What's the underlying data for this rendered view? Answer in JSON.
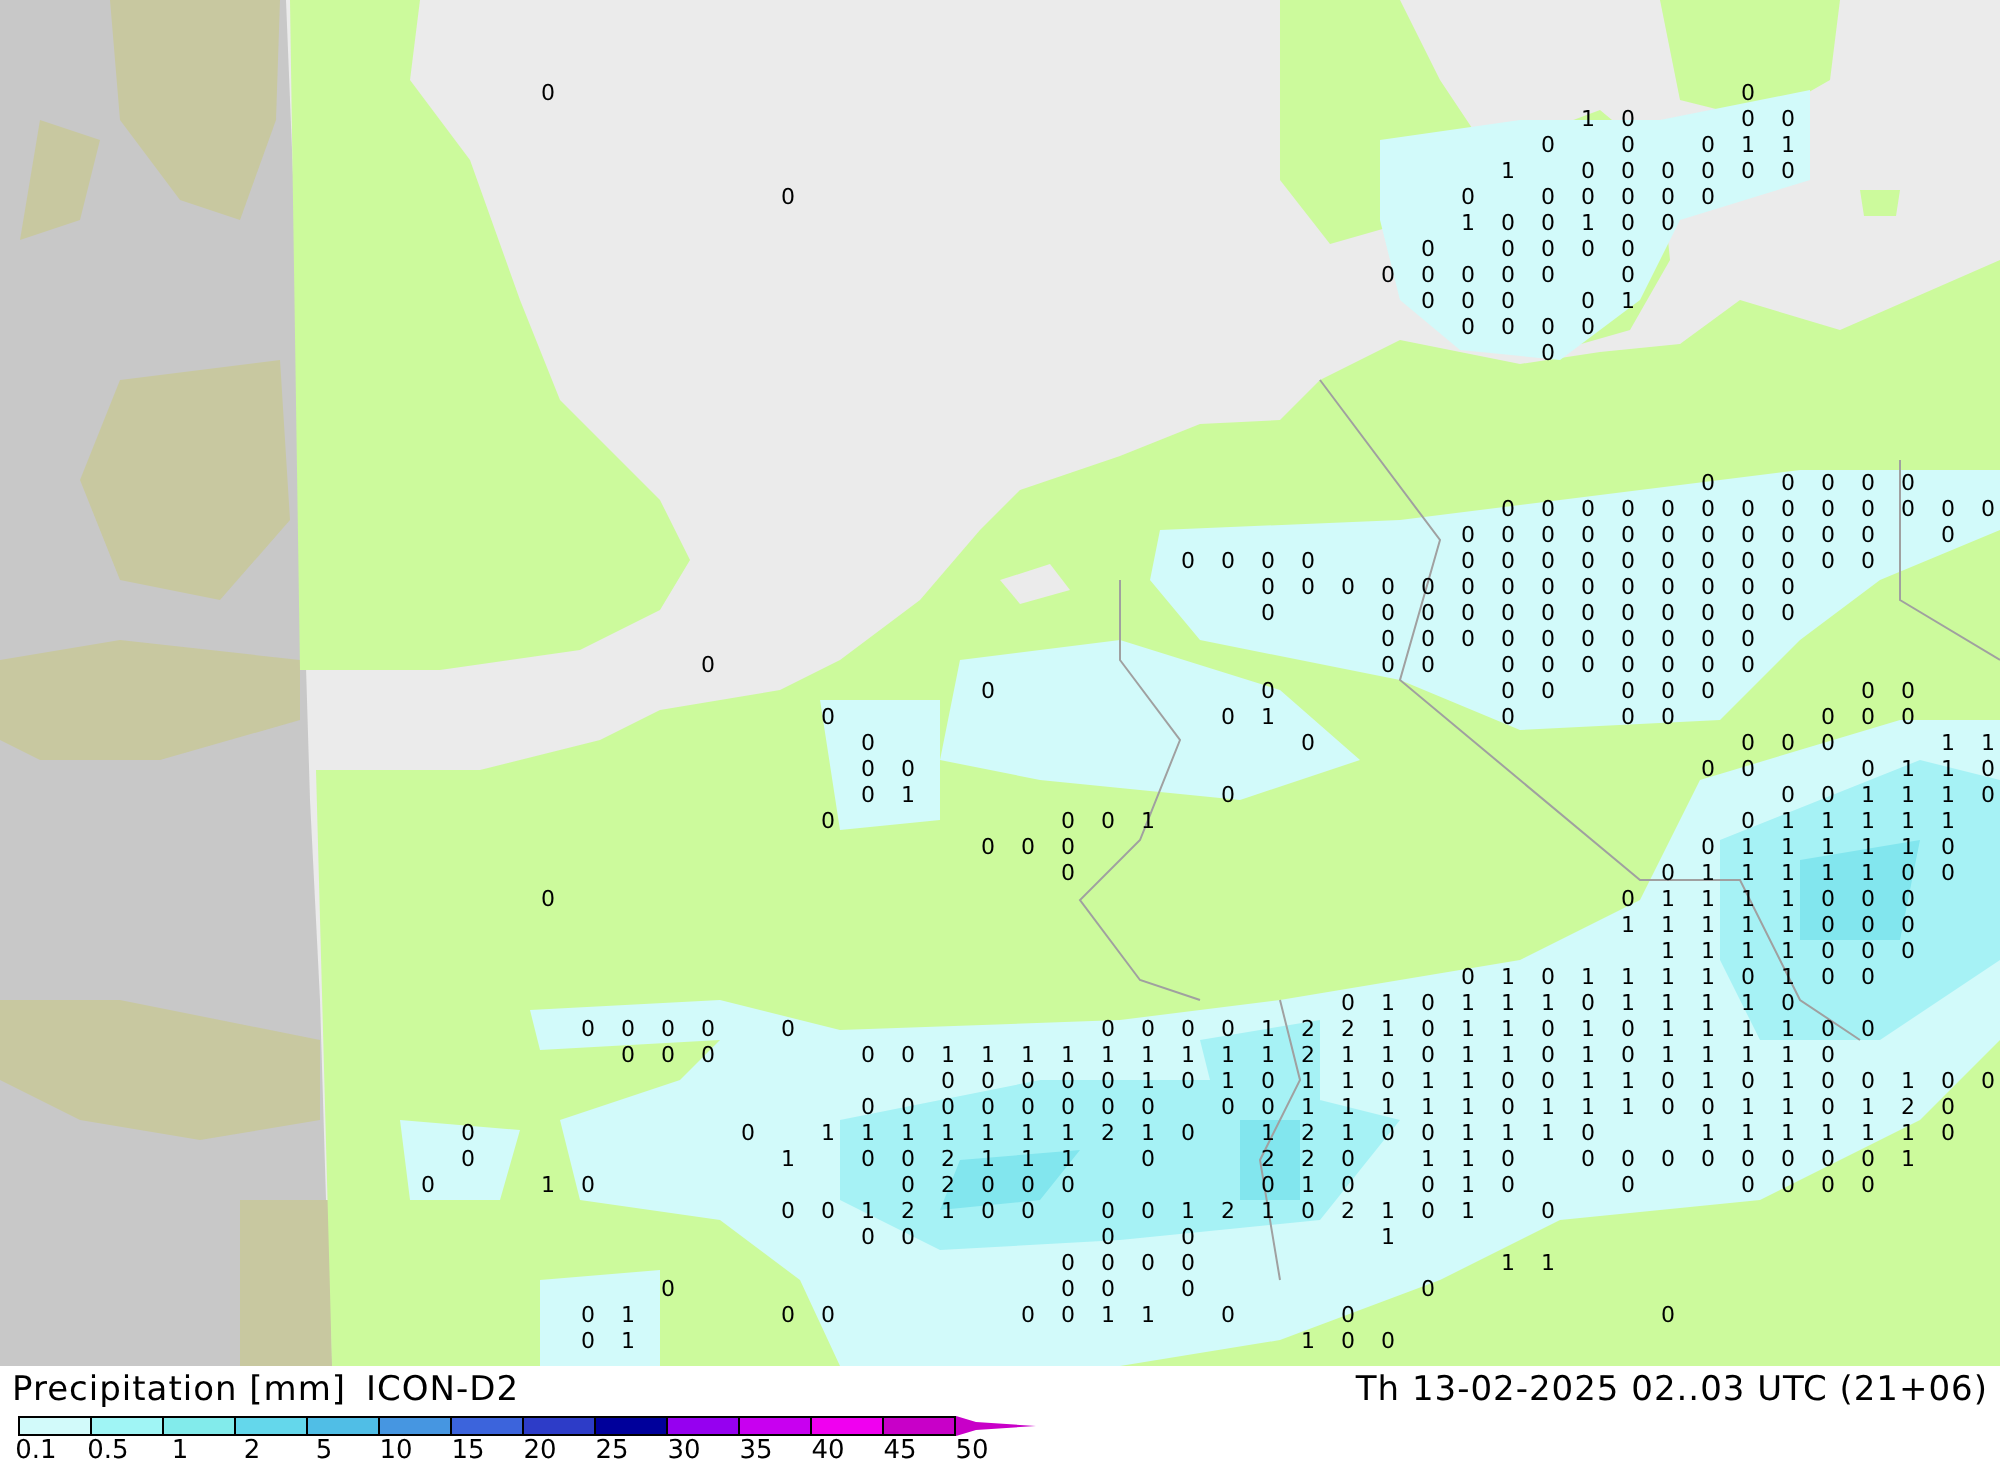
{
  "map": {
    "value_rows": [
      [
        null,
        null,
        null,
        null,
        null,
        null,
        null,
        null,
        null,
        null,
        null,
        null,
        null,
        "0",
        null,
        null,
        null,
        null,
        null,
        null,
        null,
        null,
        null,
        null,
        null,
        null,
        null,
        null,
        null,
        null,
        null,
        null,
        null,
        null,
        null,
        null,
        null,
        null,
        null,
        null,
        null,
        null,
        null,
        "0"
      ],
      [
        null,
        null,
        null,
        null,
        null,
        null,
        null,
        null,
        null,
        null,
        null,
        null,
        null,
        null,
        null,
        null,
        null,
        null,
        null,
        null,
        null,
        null,
        null,
        null,
        null,
        null,
        null,
        null,
        null,
        null,
        null,
        null,
        null,
        null,
        null,
        null,
        null,
        null,
        null,
        "1",
        "0",
        null,
        null,
        "0",
        "0"
      ],
      [
        null,
        null,
        null,
        null,
        null,
        null,
        null,
        null,
        null,
        null,
        null,
        null,
        null,
        null,
        null,
        null,
        null,
        null,
        null,
        null,
        null,
        null,
        null,
        null,
        null,
        null,
        null,
        null,
        null,
        null,
        null,
        null,
        null,
        null,
        null,
        null,
        null,
        null,
        "0",
        null,
        "0",
        null,
        "0",
        "1",
        "1"
      ],
      [
        null,
        null,
        null,
        null,
        null,
        null,
        null,
        null,
        null,
        null,
        null,
        null,
        null,
        null,
        null,
        null,
        null,
        null,
        null,
        null,
        null,
        null,
        null,
        null,
        null,
        null,
        null,
        null,
        null,
        null,
        null,
        null,
        null,
        null,
        null,
        null,
        null,
        "1",
        null,
        "0",
        "0",
        "0",
        "0",
        "0",
        "0"
      ],
      [
        null,
        null,
        null,
        null,
        null,
        null,
        null,
        null,
        null,
        null,
        null,
        null,
        null,
        null,
        null,
        null,
        null,
        null,
        null,
        "0",
        null,
        null,
        null,
        null,
        null,
        null,
        null,
        null,
        null,
        null,
        null,
        null,
        null,
        null,
        null,
        null,
        "0",
        null,
        "0",
        "0",
        "0",
        "0",
        "0"
      ],
      [
        null,
        null,
        null,
        null,
        null,
        null,
        null,
        null,
        null,
        null,
        null,
        null,
        null,
        null,
        null,
        null,
        null,
        null,
        null,
        null,
        null,
        null,
        null,
        null,
        null,
        null,
        null,
        null,
        null,
        null,
        null,
        null,
        null,
        null,
        null,
        null,
        "1",
        "0",
        "0",
        "1",
        "0",
        "0"
      ],
      [
        null,
        null,
        null,
        null,
        null,
        null,
        null,
        null,
        null,
        null,
        null,
        null,
        null,
        null,
        null,
        null,
        null,
        null,
        null,
        null,
        null,
        null,
        null,
        null,
        null,
        null,
        null,
        null,
        null,
        null,
        null,
        null,
        null,
        null,
        null,
        "0",
        null,
        "0",
        "0",
        "0",
        "0"
      ],
      [
        null,
        null,
        null,
        null,
        null,
        null,
        null,
        null,
        null,
        null,
        null,
        null,
        null,
        null,
        null,
        null,
        null,
        null,
        null,
        null,
        null,
        null,
        null,
        null,
        null,
        null,
        null,
        null,
        null,
        null,
        null,
        null,
        null,
        null,
        "0",
        "0",
        "0",
        "0",
        "0",
        null,
        "0"
      ],
      [
        null,
        null,
        null,
        null,
        null,
        null,
        null,
        null,
        null,
        null,
        null,
        null,
        null,
        null,
        null,
        null,
        null,
        null,
        null,
        null,
        null,
        null,
        null,
        null,
        null,
        null,
        null,
        null,
        null,
        null,
        null,
        null,
        null,
        null,
        null,
        "0",
        "0",
        "0",
        null,
        "0",
        "1"
      ],
      [
        null,
        null,
        null,
        null,
        null,
        null,
        null,
        null,
        null,
        null,
        null,
        null,
        null,
        null,
        null,
        null,
        null,
        null,
        null,
        null,
        null,
        null,
        null,
        null,
        null,
        null,
        null,
        null,
        null,
        null,
        null,
        null,
        null,
        null,
        null,
        null,
        "0",
        "0",
        "0",
        "0"
      ],
      [
        null,
        null,
        null,
        null,
        null,
        null,
        null,
        null,
        null,
        null,
        null,
        null,
        null,
        null,
        null,
        null,
        null,
        null,
        null,
        null,
        null,
        null,
        null,
        null,
        null,
        null,
        null,
        null,
        null,
        null,
        null,
        null,
        null,
        null,
        null,
        null,
        null,
        null,
        "0"
      ],
      [
        null
      ],
      [
        null
      ],
      [
        null
      ],
      [
        null
      ],
      [
        null,
        null,
        null,
        null,
        null,
        null,
        null,
        null,
        null,
        null,
        null,
        null,
        null,
        null,
        null,
        null,
        null,
        null,
        null,
        null,
        null,
        null,
        null,
        null,
        null,
        null,
        null,
        null,
        null,
        null,
        null,
        null,
        null,
        null,
        null,
        null,
        null,
        null,
        null,
        null,
        null,
        null,
        "0",
        null,
        "0",
        "0",
        "0",
        "0"
      ],
      [
        null,
        null,
        null,
        null,
        null,
        null,
        null,
        null,
        null,
        null,
        null,
        null,
        null,
        null,
        null,
        null,
        null,
        null,
        null,
        null,
        null,
        null,
        null,
        null,
        null,
        null,
        null,
        null,
        null,
        null,
        null,
        null,
        null,
        null,
        null,
        null,
        null,
        "0",
        "0",
        "0",
        "0",
        "0",
        "0",
        "0",
        "0",
        "0",
        "0",
        "0",
        "0",
        "0"
      ],
      [
        null,
        null,
        null,
        null,
        null,
        null,
        null,
        null,
        null,
        null,
        null,
        null,
        null,
        null,
        null,
        null,
        null,
        null,
        null,
        null,
        null,
        null,
        null,
        null,
        null,
        null,
        null,
        null,
        null,
        null,
        null,
        null,
        null,
        null,
        null,
        null,
        "0",
        "0",
        "0",
        "0",
        "0",
        "0",
        "0",
        "0",
        "0",
        "0",
        "0",
        null,
        "0"
      ],
      [
        null,
        null,
        null,
        null,
        null,
        null,
        null,
        null,
        null,
        null,
        null,
        null,
        null,
        null,
        null,
        null,
        null,
        null,
        null,
        null,
        null,
        null,
        null,
        null,
        null,
        null,
        null,
        null,
        null,
        "0",
        "0",
        "0",
        "0",
        null,
        null,
        null,
        "0",
        "0",
        "0",
        "0",
        "0",
        "0",
        "0",
        "0",
        "0",
        "0",
        "0"
      ],
      [
        null,
        null,
        null,
        null,
        null,
        null,
        null,
        null,
        null,
        null,
        null,
        null,
        null,
        null,
        null,
        null,
        null,
        null,
        null,
        null,
        null,
        null,
        null,
        null,
        null,
        null,
        null,
        null,
        null,
        null,
        null,
        "0",
        "0",
        "0",
        "0",
        "0",
        "0",
        "0",
        "0",
        "0",
        "0",
        "0",
        "0",
        "0",
        "0"
      ],
      [
        null,
        null,
        null,
        null,
        null,
        null,
        null,
        null,
        null,
        null,
        null,
        null,
        null,
        null,
        null,
        null,
        null,
        null,
        null,
        null,
        null,
        null,
        null,
        null,
        null,
        null,
        null,
        null,
        null,
        null,
        null,
        "0",
        null,
        null,
        "0",
        "0",
        "0",
        "0",
        "0",
        "0",
        "0",
        "0",
        "0",
        "0",
        "0"
      ],
      [
        null,
        null,
        null,
        null,
        null,
        null,
        null,
        null,
        null,
        null,
        null,
        null,
        null,
        null,
        null,
        null,
        null,
        null,
        null,
        null,
        null,
        null,
        null,
        null,
        null,
        null,
        null,
        null,
        null,
        null,
        null,
        null,
        null,
        null,
        "0",
        "0",
        "0",
        "0",
        "0",
        "0",
        "0",
        "0",
        "0",
        "0"
      ],
      [
        null,
        null,
        null,
        null,
        null,
        null,
        null,
        null,
        null,
        null,
        null,
        null,
        null,
        null,
        null,
        null,
        null,
        "0",
        null,
        null,
        null,
        null,
        null,
        null,
        null,
        null,
        null,
        null,
        null,
        null,
        null,
        null,
        null,
        null,
        "0",
        "0",
        null,
        "0",
        "0",
        "0",
        "0",
        "0",
        "0",
        "0"
      ],
      [
        null,
        null,
        null,
        null,
        null,
        null,
        null,
        null,
        null,
        null,
        null,
        null,
        null,
        null,
        null,
        null,
        null,
        null,
        null,
        null,
        null,
        null,
        null,
        null,
        "0",
        null,
        null,
        null,
        null,
        null,
        null,
        "0",
        null,
        null,
        null,
        null,
        null,
        "0",
        "0",
        null,
        "0",
        "0",
        "0",
        null,
        null,
        null,
        "0",
        "0"
      ],
      [
        null,
        null,
        null,
        null,
        null,
        null,
        null,
        null,
        null,
        null,
        null,
        null,
        null,
        null,
        null,
        null,
        null,
        null,
        null,
        null,
        "0",
        null,
        null,
        null,
        null,
        null,
        null,
        null,
        null,
        null,
        "0",
        "1",
        null,
        null,
        null,
        null,
        null,
        "0",
        null,
        null,
        "0",
        "0",
        null,
        null,
        null,
        "0",
        "0",
        "0"
      ],
      [
        null,
        null,
        null,
        null,
        null,
        null,
        null,
        null,
        null,
        null,
        null,
        null,
        null,
        null,
        null,
        null,
        null,
        null,
        null,
        null,
        null,
        "0",
        null,
        null,
        null,
        null,
        null,
        null,
        null,
        null,
        null,
        null,
        "0",
        null,
        null,
        null,
        null,
        null,
        null,
        null,
        null,
        null,
        null,
        "0",
        "0",
        "0",
        null,
        null,
        "1",
        "1"
      ],
      [
        null,
        null,
        null,
        null,
        null,
        null,
        null,
        null,
        null,
        null,
        null,
        null,
        null,
        null,
        null,
        null,
        null,
        null,
        null,
        null,
        null,
        "0",
        "0",
        null,
        null,
        null,
        null,
        null,
        null,
        null,
        null,
        null,
        null,
        null,
        null,
        null,
        null,
        null,
        null,
        null,
        null,
        null,
        "0",
        "0",
        null,
        null,
        "0",
        "1",
        "1",
        "0"
      ],
      [
        null,
        null,
        null,
        null,
        null,
        null,
        null,
        null,
        null,
        null,
        null,
        null,
        null,
        null,
        null,
        null,
        null,
        null,
        null,
        null,
        null,
        "0",
        "1",
        null,
        null,
        null,
        null,
        null,
        null,
        null,
        "0",
        null,
        null,
        null,
        null,
        null,
        null,
        null,
        null,
        null,
        null,
        null,
        null,
        null,
        "0",
        "0",
        "1",
        "1",
        "1",
        "0"
      ],
      [
        null,
        null,
        null,
        null,
        null,
        null,
        null,
        null,
        null,
        null,
        null,
        null,
        null,
        null,
        null,
        null,
        null,
        null,
        null,
        null,
        "0",
        null,
        null,
        null,
        null,
        null,
        "0",
        "0",
        "1",
        null,
        null,
        null,
        null,
        null,
        null,
        null,
        null,
        null,
        null,
        null,
        null,
        null,
        null,
        "0",
        "1",
        "1",
        "1",
        "1",
        "1"
      ],
      [
        null,
        null,
        null,
        null,
        null,
        null,
        null,
        null,
        null,
        null,
        null,
        null,
        null,
        null,
        null,
        null,
        null,
        null,
        null,
        null,
        null,
        null,
        null,
        null,
        "0",
        "0",
        "0",
        null,
        null,
        null,
        null,
        null,
        null,
        null,
        null,
        null,
        null,
        null,
        null,
        null,
        null,
        null,
        "0",
        "1",
        "1",
        "1",
        "1",
        "1",
        "0"
      ],
      [
        null,
        null,
        null,
        null,
        null,
        null,
        null,
        null,
        null,
        null,
        null,
        null,
        null,
        null,
        null,
        null,
        null,
        null,
        null,
        null,
        null,
        null,
        null,
        null,
        null,
        null,
        "0",
        null,
        null,
        null,
        null,
        null,
        null,
        null,
        null,
        null,
        null,
        null,
        null,
        null,
        null,
        "0",
        "1",
        "1",
        "1",
        "1",
        "1",
        "0",
        "0"
      ],
      [
        null,
        null,
        null,
        null,
        null,
        null,
        null,
        null,
        null,
        null,
        null,
        null,
        null,
        "0",
        null,
        null,
        null,
        null,
        null,
        null,
        null,
        null,
        null,
        null,
        null,
        null,
        null,
        null,
        null,
        null,
        null,
        null,
        null,
        null,
        null,
        null,
        null,
        null,
        null,
        null,
        "0",
        "1",
        "1",
        "1",
        "1",
        "0",
        "0",
        "0"
      ],
      [
        null,
        null,
        null,
        null,
        null,
        null,
        null,
        null,
        null,
        null,
        null,
        null,
        null,
        null,
        null,
        null,
        null,
        null,
        null,
        null,
        null,
        null,
        null,
        null,
        null,
        null,
        null,
        null,
        null,
        null,
        null,
        null,
        null,
        null,
        null,
        null,
        null,
        null,
        null,
        null,
        "1",
        "1",
        "1",
        "1",
        "1",
        "0",
        "0",
        "0"
      ],
      [
        null,
        null,
        null,
        null,
        null,
        null,
        null,
        null,
        null,
        null,
        null,
        null,
        null,
        null,
        null,
        null,
        null,
        null,
        null,
        null,
        null,
        null,
        null,
        null,
        null,
        null,
        null,
        null,
        null,
        null,
        null,
        null,
        null,
        null,
        null,
        null,
        null,
        null,
        null,
        null,
        null,
        "1",
        "1",
        "1",
        "1",
        "0",
        "0",
        "0"
      ],
      [
        null,
        null,
        null,
        null,
        null,
        null,
        null,
        null,
        null,
        null,
        null,
        null,
        null,
        null,
        null,
        null,
        null,
        null,
        null,
        null,
        null,
        null,
        null,
        null,
        null,
        null,
        null,
        null,
        null,
        null,
        null,
        null,
        null,
        null,
        null,
        null,
        "0",
        "1",
        "0",
        "1",
        "1",
        "1",
        "1",
        "0",
        "1",
        "0",
        "0"
      ],
      [
        null,
        null,
        null,
        null,
        null,
        null,
        null,
        null,
        null,
        null,
        null,
        null,
        null,
        null,
        null,
        null,
        null,
        null,
        null,
        null,
        null,
        null,
        null,
        null,
        null,
        null,
        null,
        null,
        null,
        null,
        null,
        null,
        null,
        "0",
        "1",
        "0",
        "1",
        "1",
        "1",
        "0",
        "1",
        "1",
        "1",
        "1",
        "0"
      ],
      [
        null,
        null,
        null,
        null,
        null,
        null,
        null,
        null,
        null,
        null,
        null,
        null,
        null,
        null,
        "0",
        "0",
        "0",
        "0",
        null,
        "0",
        null,
        null,
        null,
        null,
        null,
        null,
        null,
        "0",
        "0",
        "0",
        "0",
        "1",
        "2",
        "2",
        "1",
        "0",
        "1",
        "1",
        "0",
        "1",
        "0",
        "1",
        "1",
        "1",
        "1",
        "0",
        "0"
      ],
      [
        null,
        null,
        null,
        null,
        null,
        null,
        null,
        null,
        null,
        null,
        null,
        null,
        null,
        null,
        null,
        "0",
        "0",
        "0",
        null,
        null,
        null,
        "0",
        "0",
        "1",
        "1",
        "1",
        "1",
        "1",
        "1",
        "1",
        "1",
        "1",
        "2",
        "1",
        "1",
        "0",
        "1",
        "1",
        "0",
        "1",
        "0",
        "1",
        "1",
        "1",
        "1",
        "0"
      ],
      [
        null,
        null,
        null,
        null,
        null,
        null,
        null,
        null,
        null,
        null,
        null,
        null,
        null,
        null,
        null,
        null,
        null,
        null,
        null,
        null,
        null,
        null,
        null,
        "0",
        "0",
        "0",
        "0",
        "0",
        "1",
        "0",
        "1",
        "0",
        "1",
        "1",
        "0",
        "1",
        "1",
        "0",
        "0",
        "1",
        "1",
        "0",
        "1",
        "0",
        "1",
        "0",
        "0",
        "1",
        "0",
        "0"
      ],
      [
        null,
        null,
        null,
        null,
        null,
        null,
        null,
        null,
        null,
        null,
        null,
        null,
        null,
        null,
        null,
        null,
        null,
        null,
        null,
        null,
        null,
        "0",
        "0",
        "0",
        "0",
        "0",
        "0",
        "0",
        "0",
        null,
        "0",
        "0",
        "1",
        "1",
        "1",
        "1",
        "1",
        "0",
        "1",
        "1",
        "1",
        "0",
        "0",
        "1",
        "1",
        "0",
        "1",
        "2",
        "0"
      ],
      [
        null,
        null,
        null,
        null,
        null,
        null,
        null,
        null,
        null,
        null,
        null,
        "0",
        null,
        null,
        null,
        null,
        null,
        null,
        "0",
        null,
        "1",
        "1",
        "1",
        "1",
        "1",
        "1",
        "1",
        "2",
        "1",
        "0",
        null,
        "1",
        "2",
        "1",
        "0",
        "0",
        "1",
        "1",
        "1",
        "0",
        null,
        null,
        "1",
        "1",
        "1",
        "1",
        "1",
        "1",
        "0"
      ],
      [
        null,
        null,
        null,
        null,
        null,
        null,
        null,
        null,
        null,
        null,
        null,
        "0",
        null,
        null,
        null,
        null,
        null,
        null,
        null,
        "1",
        null,
        "0",
        "0",
        "2",
        "1",
        "1",
        "1",
        null,
        "0",
        null,
        null,
        "2",
        "2",
        "0",
        null,
        "1",
        "1",
        "0",
        null,
        "0",
        "0",
        "0",
        "0",
        "0",
        "0",
        "0",
        "0",
        "1"
      ],
      [
        null,
        null,
        null,
        null,
        null,
        null,
        null,
        null,
        null,
        null,
        "0",
        null,
        null,
        "1",
        "0",
        null,
        null,
        null,
        null,
        null,
        null,
        null,
        "0",
        "2",
        "0",
        "0",
        "0",
        null,
        null,
        null,
        null,
        "0",
        "1",
        "0",
        null,
        "0",
        "1",
        "0",
        null,
        null,
        "0",
        null,
        null,
        "0",
        "0",
        "0",
        "0"
      ],
      [
        null,
        null,
        null,
        null,
        null,
        null,
        null,
        null,
        null,
        null,
        null,
        null,
        null,
        null,
        null,
        null,
        null,
        null,
        null,
        "0",
        "0",
        "1",
        "2",
        "1",
        "0",
        "0",
        null,
        "0",
        "0",
        "1",
        "2",
        "1",
        "0",
        "2",
        "1",
        "0",
        "1",
        null,
        "0"
      ],
      [
        null,
        null,
        null,
        null,
        null,
        null,
        null,
        null,
        null,
        null,
        null,
        null,
        null,
        null,
        null,
        null,
        null,
        null,
        null,
        null,
        null,
        "0",
        "0",
        null,
        null,
        null,
        null,
        "0",
        null,
        "0",
        null,
        null,
        null,
        null,
        "1"
      ],
      [
        null,
        null,
        null,
        null,
        null,
        null,
        null,
        null,
        null,
        null,
        null,
        null,
        null,
        null,
        null,
        null,
        null,
        null,
        null,
        null,
        null,
        null,
        null,
        null,
        null,
        null,
        "0",
        "0",
        "0",
        "0",
        null,
        null,
        null,
        null,
        null,
        null,
        null,
        "1",
        "1"
      ],
      [
        null,
        null,
        null,
        null,
        null,
        null,
        null,
        null,
        null,
        null,
        null,
        null,
        null,
        null,
        null,
        null,
        "0",
        null,
        null,
        null,
        null,
        null,
        null,
        null,
        null,
        null,
        "0",
        "0",
        null,
        "0",
        null,
        null,
        null,
        null,
        null,
        "0"
      ],
      [
        null,
        null,
        null,
        null,
        null,
        null,
        null,
        null,
        null,
        null,
        null,
        null,
        null,
        null,
        "0",
        "1",
        null,
        null,
        null,
        "0",
        "0",
        null,
        null,
        null,
        null,
        "0",
        "0",
        "1",
        "1",
        null,
        "0",
        null,
        null,
        "0",
        null,
        null,
        null,
        null,
        null,
        null,
        null,
        "0"
      ],
      [
        null,
        null,
        null,
        null,
        null,
        null,
        null,
        null,
        null,
        null,
        null,
        null,
        null,
        null,
        "0",
        "1",
        null,
        null,
        null,
        null,
        null,
        null,
        null,
        null,
        null,
        null,
        null,
        null,
        null,
        null,
        null,
        null,
        "1",
        "0",
        "0"
      ]
    ]
  },
  "legend": {
    "title": "Precipitation [mm]",
    "model": "ICON-D2",
    "valid_time": "Th 13-02-2025 02..03 UTC (21+06)",
    "scale": [
      {
        "color": "#d2fafa"
      },
      {
        "color": "#a0f5f5"
      },
      {
        "color": "#82ebeb"
      },
      {
        "color": "#64d7eb"
      },
      {
        "color": "#50bee6"
      },
      {
        "color": "#4696e1"
      },
      {
        "color": "#3c64dc"
      },
      {
        "color": "#2d3cc8"
      },
      {
        "color": "#00009b"
      },
      {
        "color": "#9600f0"
      },
      {
        "color": "#c800f0"
      },
      {
        "color": "#f000f0"
      },
      {
        "color": "#c800c8"
      }
    ],
    "ticks": [
      "0.1",
      "0.5",
      "1",
      "2",
      "5",
      "10",
      "15",
      "20",
      "25",
      "30",
      "35",
      "40",
      "45",
      "50"
    ]
  }
}
